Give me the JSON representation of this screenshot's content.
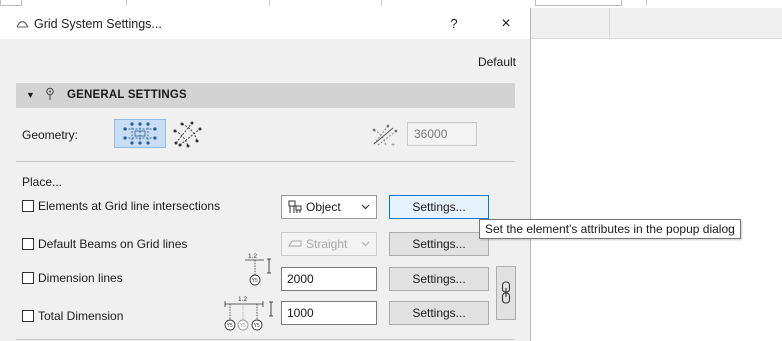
{
  "window": {
    "title": "Grid System Settings...",
    "help_label": "?",
    "close_label": "×"
  },
  "favorites": {
    "default_label": "Default"
  },
  "general_settings": {
    "section_title": "GENERAL SETTINGS",
    "geometry_label": "Geometry:",
    "geometry_options": [
      "rectangular-grid",
      "polar-grid"
    ],
    "selected_geometry": "rectangular-grid",
    "radius_value": "36000"
  },
  "place": {
    "label": "Place...",
    "rows": [
      {
        "label": "Elements at Grid line intersections",
        "checked": false,
        "control": "Object",
        "button": "Settings..."
      },
      {
        "label": "Default Beams on Grid lines",
        "checked": false,
        "control": "Straight",
        "control_disabled": true,
        "button": "Settings..."
      },
      {
        "label": "Dimension lines",
        "checked": false,
        "value": "2000",
        "button": "Settings..."
      },
      {
        "label": "Total Dimension",
        "checked": false,
        "value": "1000",
        "button": "Settings..."
      }
    ],
    "dimension_icon_label": "1.2",
    "dimension_marker": "Y5"
  },
  "tooltip": {
    "text": "Set the element's attributes in the popup dialog"
  },
  "colors": {
    "accent": "#0078d7",
    "selected_bg": "#c6ddf3",
    "section_bg": "#d3d3d3",
    "dialog_bg": "#f0f0f0"
  }
}
